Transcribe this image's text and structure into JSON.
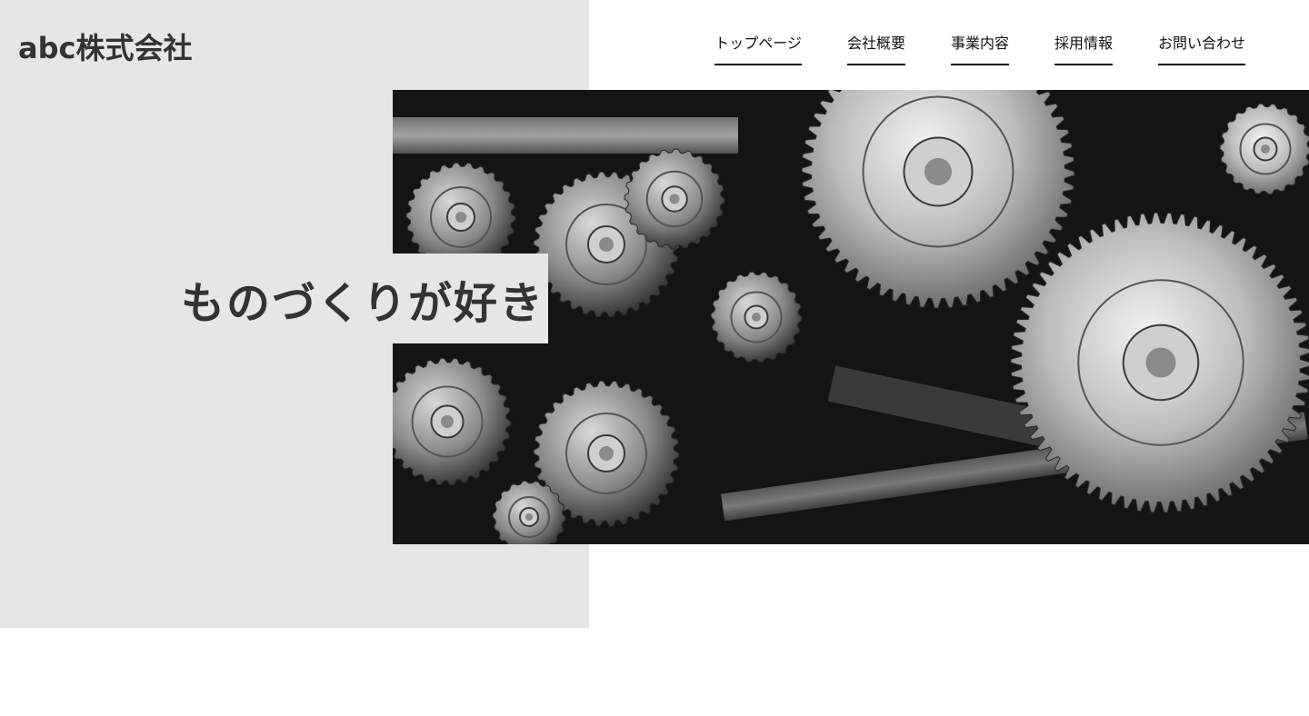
{
  "header": {
    "logo": "abc株式会社",
    "nav": [
      {
        "label": "トップページ"
      },
      {
        "label": "会社概要"
      },
      {
        "label": "事業内容"
      },
      {
        "label": "採用情報"
      },
      {
        "label": "お問い合わせ"
      }
    ]
  },
  "hero": {
    "tagline": "ものづくりが好き",
    "image": "gears-machinery"
  },
  "colors": {
    "panel": "#e6e6e6",
    "text": "#333333",
    "nav_text": "#111111"
  }
}
